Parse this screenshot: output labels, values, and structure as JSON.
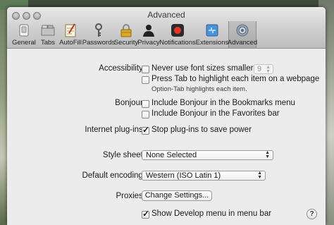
{
  "window": {
    "title": "Advanced"
  },
  "toolbar": {
    "items": [
      {
        "label": "General",
        "icon": "switch-icon"
      },
      {
        "label": "Tabs",
        "icon": "tabs-icon"
      },
      {
        "label": "AutoFill",
        "icon": "autofill-icon"
      },
      {
        "label": "Passwords",
        "icon": "key-icon"
      },
      {
        "label": "Security",
        "icon": "padlock-icon"
      },
      {
        "label": "Privacy",
        "icon": "person-silhouette-icon"
      },
      {
        "label": "Notifications",
        "icon": "notification-dot-icon"
      },
      {
        "label": "Extensions",
        "icon": "puzzle-icon"
      },
      {
        "label": "Advanced",
        "icon": "gear-icon",
        "selected": true
      }
    ]
  },
  "accessibility": {
    "label": "Accessibility:",
    "font_size_option": "Never use font sizes smaller than",
    "font_size_value": "9",
    "font_size_checked": false,
    "tab_option": "Press Tab to highlight each item on a webpage",
    "tab_checked": false,
    "tab_hint": "Option-Tab highlights each item."
  },
  "bonjour": {
    "label": "Bonjour:",
    "bookmarks_option": "Include Bonjour in the Bookmarks menu",
    "bookmarks_checked": false,
    "favorites_option": "Include Bonjour in the Favorites bar",
    "favorites_checked": false
  },
  "plugins": {
    "label": "Internet plug-ins:",
    "stop_option": "Stop plug-ins to save power",
    "stop_checked": true
  },
  "stylesheet": {
    "label": "Style sheet:",
    "value": "None Selected"
  },
  "encoding": {
    "label": "Default encoding:",
    "value": "Western (ISO Latin 1)"
  },
  "proxies": {
    "label": "Proxies:",
    "button": "Change Settings..."
  },
  "develop": {
    "option": "Show Develop menu in menu bar",
    "checked": true
  },
  "help": {
    "label": "?"
  }
}
